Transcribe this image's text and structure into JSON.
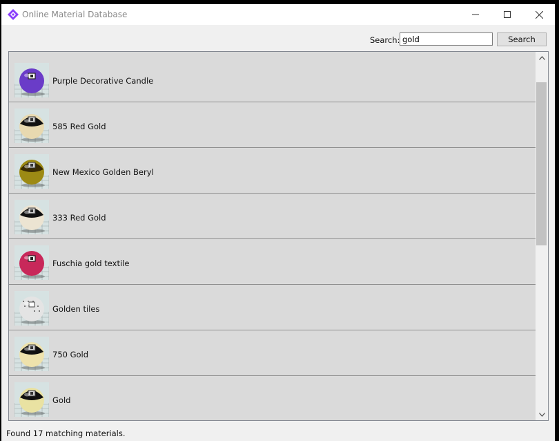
{
  "window": {
    "title": "Online Material Database",
    "accent_color": "#8a3ffc",
    "icons": [
      "app-logo-icon",
      "minimize-icon",
      "maximize-icon",
      "close-icon"
    ]
  },
  "search": {
    "label": "Search:",
    "value": "gold",
    "button_label": "Search"
  },
  "materials": [
    {
      "name": "Purple Decorative Candle",
      "color": "#6a3cc8",
      "style": "matte"
    },
    {
      "name": "585 Red Gold",
      "color": "#e8d9b0",
      "style": "metal"
    },
    {
      "name": "New Mexico Golden Beryl",
      "color": "#9c8a14",
      "style": "gem"
    },
    {
      "name": "333 Red Gold",
      "color": "#ece4d2",
      "style": "metal"
    },
    {
      "name": "Fuschia gold textile",
      "color": "#c8285a",
      "style": "matte"
    },
    {
      "name": "Golden tiles",
      "color": "#e4e4e4",
      "style": "tiles"
    },
    {
      "name": "750 Gold",
      "color": "#eee2ac",
      "style": "metal"
    },
    {
      "name": "Gold",
      "color": "#e9e2a2",
      "style": "metal"
    }
  ],
  "status": {
    "text": "Found 17 matching materials."
  },
  "scrollbar": {
    "position_fraction": 0.0,
    "icons": [
      "chevron-up-icon",
      "chevron-down-icon"
    ]
  }
}
